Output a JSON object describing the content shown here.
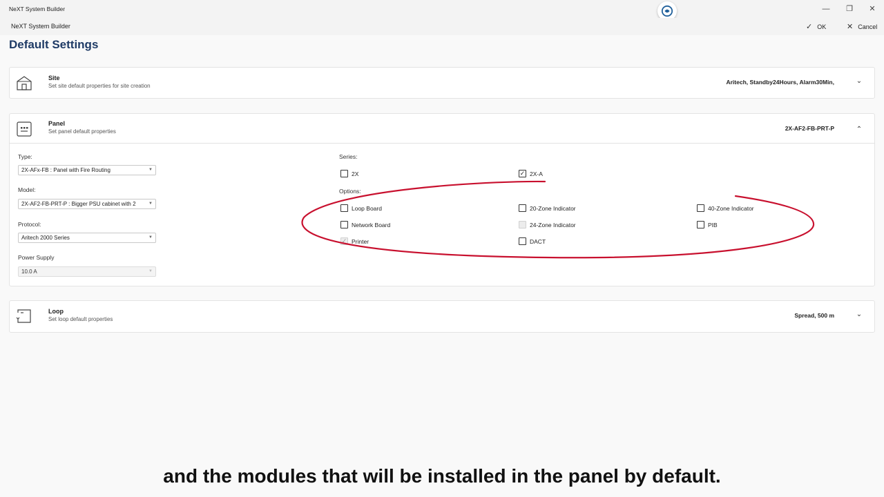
{
  "window": {
    "app_title": "NeXT System Builder",
    "minimize": "—",
    "restore": "❐",
    "close": "✕"
  },
  "commandbar": {
    "title": "NeXT System Builder",
    "ok_label": "OK",
    "cancel_label": "Cancel",
    "ok_icon": "✓",
    "cancel_icon": "✕"
  },
  "page_title": "Default Settings",
  "site": {
    "title": "Site",
    "subtitle": "Set site default properties for site creation",
    "value": "Aritech, Standby24Hours, Alarm30Min,",
    "chevron": "⌄"
  },
  "panel": {
    "title": "Panel",
    "subtitle": "Set panel default properties",
    "value": "2X-AF2-FB-PRT-P",
    "chevron": "⌃",
    "type_label": "Type:",
    "type_value": "2X-AFx-FB : Panel with Fire Routing",
    "model_label": "Model:",
    "model_value": "2X-AF2-FB-PRT-P : Bigger PSU cabinet with 2",
    "protocol_label": "Protocol:",
    "protocol_value": "Aritech 2000 Series",
    "power_label": "Power Supply",
    "power_value": "10.0 A",
    "series_label": "Series:",
    "series": [
      {
        "label": "2X",
        "checked": false
      },
      {
        "label": "2X-A",
        "checked": true
      }
    ],
    "options_label": "Options:",
    "options": [
      {
        "label": "Loop Board",
        "checked": false,
        "disabled": false
      },
      {
        "label": "20-Zone Indicator",
        "checked": false,
        "disabled": false
      },
      {
        "label": "40-Zone Indicator",
        "checked": false,
        "disabled": false
      },
      {
        "label": "Network Board",
        "checked": false,
        "disabled": false
      },
      {
        "label": "24-Zone Indicator",
        "checked": false,
        "disabled": true
      },
      {
        "label": "PIB",
        "checked": false,
        "disabled": false
      },
      {
        "label": "Printer",
        "checked": true,
        "disabled": true
      },
      {
        "label": "DACT",
        "checked": false,
        "disabled": false
      }
    ]
  },
  "loop": {
    "title": "Loop",
    "subtitle": "Set loop default properties",
    "value": "Spread, 500 m",
    "chevron": "⌄"
  },
  "caption": "and the modules that will be installed in the panel by default.",
  "colors": {
    "title_blue": "#1f3b66",
    "annotation_red": "#c8102e"
  }
}
